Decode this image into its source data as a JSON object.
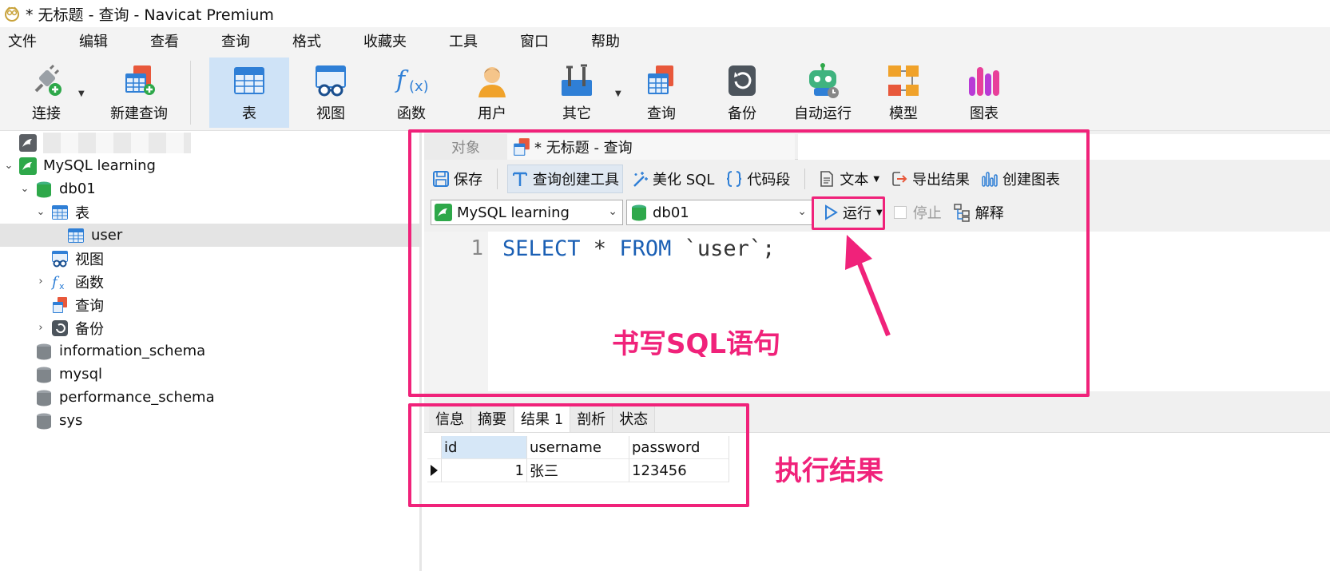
{
  "window": {
    "title": "* 无标题 - 查询 - Navicat Premium"
  },
  "menu": [
    "文件",
    "编辑",
    "查看",
    "查询",
    "格式",
    "收藏夹",
    "工具",
    "窗口",
    "帮助"
  ],
  "toolbar": {
    "connect": "连接",
    "new_query": "新建查询",
    "table": "表",
    "view": "视图",
    "function": "函数",
    "user": "用户",
    "other": "其它",
    "query": "查询",
    "backup": "备份",
    "automation": "自动运行",
    "model": "模型",
    "chart": "图表"
  },
  "tree": {
    "connection": "MySQL learning",
    "database": "db01",
    "tables_folder": "表",
    "table_user": "user",
    "views": "视图",
    "functions": "函数",
    "queries": "查询",
    "backups": "备份",
    "other_dbs": [
      "information_schema",
      "mysql",
      "performance_schema",
      "sys"
    ]
  },
  "tabs": {
    "objects": "对象",
    "query": "* 无标题 - 查询"
  },
  "query_toolbar": {
    "save": "保存",
    "query_builder": "查询创建工具",
    "beautify": "美化 SQL",
    "snippet": "代码段",
    "text": "文本",
    "export": "导出结果",
    "create_chart": "创建图表"
  },
  "connection_bar": {
    "connection": "MySQL learning",
    "database": "db01",
    "run": "运行",
    "stop": "停止",
    "explain": "解释"
  },
  "editor": {
    "line_number": "1",
    "sql_select": "SELECT",
    "sql_star": " * ",
    "sql_from": "FROM",
    "sql_rest": " `user`;"
  },
  "result_tabs": [
    "信息",
    "摘要",
    "结果 1",
    "剖析",
    "状态"
  ],
  "result_grid": {
    "columns": [
      "id",
      "username",
      "password"
    ],
    "rows": [
      [
        "1",
        "张三",
        "123456"
      ]
    ]
  },
  "annotations": {
    "write_sql": "书写SQL语句",
    "result": "执行结果"
  },
  "colors": {
    "accent": "#f0227a",
    "selection": "#cfe3f7",
    "keyword": "#1a5fb4"
  }
}
